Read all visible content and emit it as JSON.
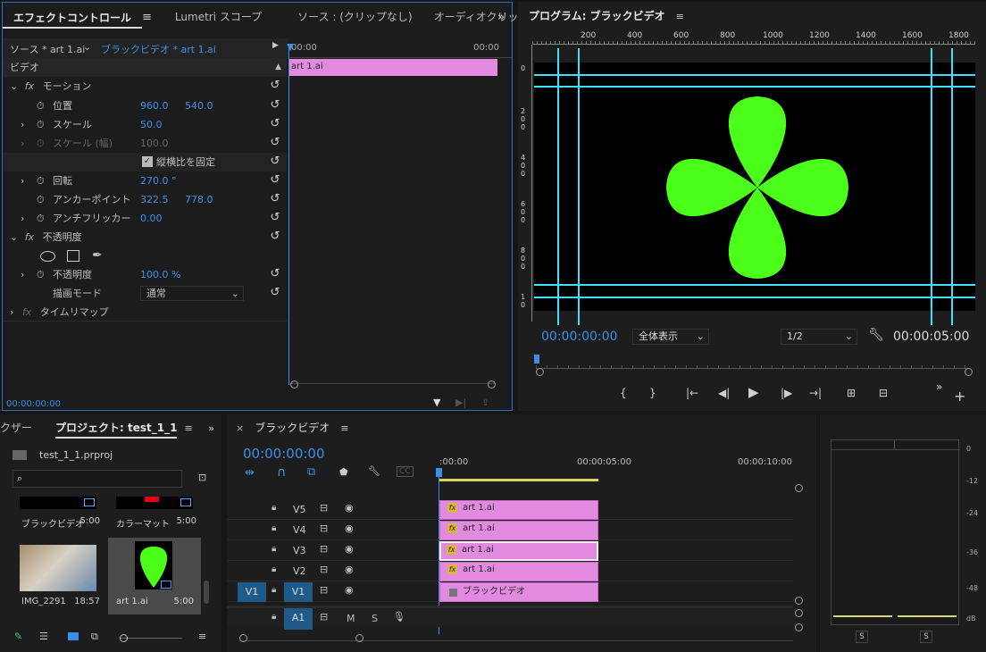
{
  "effect_panel": {
    "tabs": [
      "エフェクトコントロール",
      "Lumetri スコープ",
      "ソース : (クリップなし)",
      "オーディオクリッ"
    ],
    "source_label": "ソース * art 1.ai",
    "clip_label": "ブラックビデオ * art 1.ai",
    "ruler_start": "00:00",
    "ruler_end": "00:00",
    "clip_name": "art 1.ai",
    "section_video": "ビデオ",
    "motion": "モーション",
    "position_label": "位置",
    "position_x": "960.0",
    "position_y": "540.0",
    "scale_label": "スケール",
    "scale_value": "50.0",
    "scale_width_label": "スケール (幅)",
    "scale_width_value": "100.0",
    "uniform_label": "縦横比を固定",
    "rotation_label": "回転",
    "rotation_value": "270.0 °",
    "anchor_label": "アンカーポイント",
    "anchor_x": "322.5",
    "anchor_y": "778.0",
    "flicker_label": "アンチフリッカー",
    "flicker_value": "0.00",
    "opacity_section": "不透明度",
    "opacity_label": "不透明度",
    "opacity_value": "100.0 %",
    "blend_label": "描画モード",
    "blend_value": "通常",
    "time_remap": "タイムリマップ",
    "timecode": "00:00:00:00"
  },
  "program": {
    "title": "プログラム: ブラックビデオ",
    "ruler_marks": [
      "200",
      "400",
      "600",
      "800",
      "1000",
      "1200",
      "1400",
      "1600",
      "1800"
    ],
    "vruler_marks": [
      "0",
      "2\n0\n0",
      "4\n0\n0",
      "6\n0\n0",
      "8\n0\n0",
      "1\n0"
    ],
    "timecode": "00:00:00:00",
    "fit": "全体表示",
    "quality": "1/2",
    "duration": "00:00:05:00",
    "clover_color": "#4cff1a"
  },
  "project": {
    "tabs": [
      "クザー",
      "プロジェクト: test_1_1"
    ],
    "file": "test_1_1.prproj",
    "items": [
      {
        "name": "ブラックビデオ",
        "duration": "5:00"
      },
      {
        "name": "カラーマット",
        "duration": "5:00"
      },
      {
        "name": "IMG_2291",
        "duration": "18:57"
      },
      {
        "name": "art 1.ai",
        "duration": "5:00"
      }
    ]
  },
  "timeline": {
    "title": "ブラックビデオ",
    "timecode": "00:00:00:00",
    "ruler": [
      ":00:00",
      "00:00:05:00",
      "00:00:10:00"
    ],
    "tracks": [
      {
        "name": "V5",
        "clip": "art 1.ai"
      },
      {
        "name": "V4",
        "clip": "art 1.ai"
      },
      {
        "name": "V3",
        "clip": "art 1.ai"
      },
      {
        "name": "V2",
        "clip": "art 1.ai"
      },
      {
        "name": "V1",
        "clip": "ブラックビデオ"
      }
    ],
    "src_v1": "V1",
    "audio": "A1",
    "m": "M",
    "s": "S"
  },
  "audio_meter": {
    "marks": [
      "0",
      "-12",
      "-24",
      "-36",
      "-48",
      "dB"
    ],
    "solo": [
      "S",
      "S"
    ]
  }
}
